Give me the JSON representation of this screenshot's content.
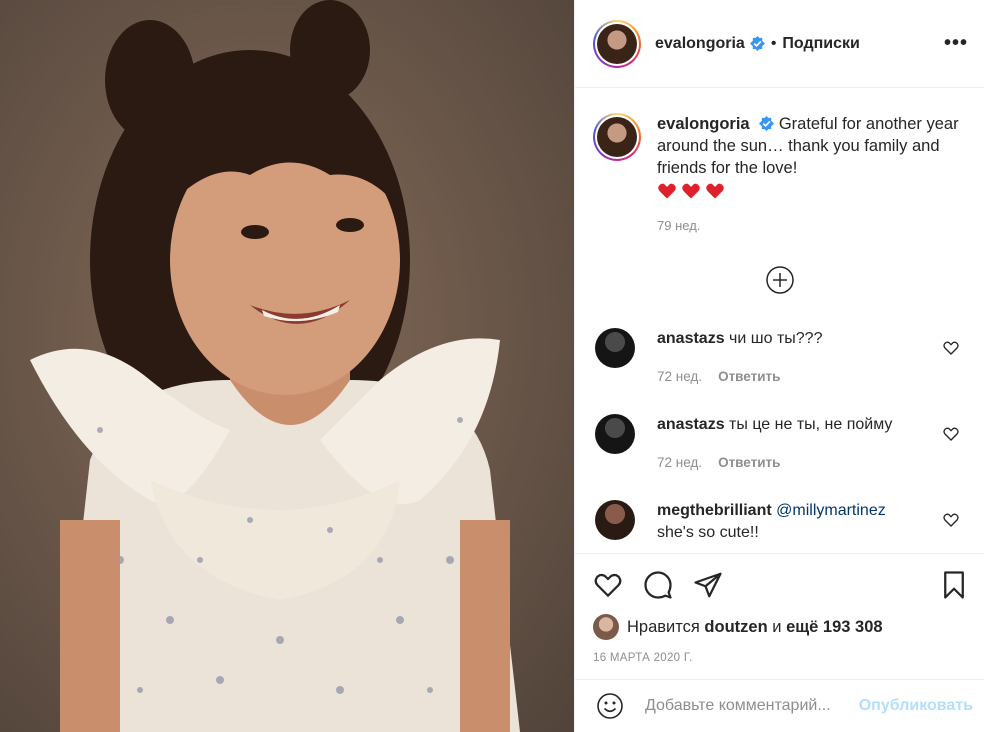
{
  "post": {
    "username": "evalongoria",
    "follow_separator": "•",
    "follow_label": "Подписки",
    "more_label": "•••",
    "caption_text": "Grateful for another year around the sun… thank you family and friends for the love!",
    "caption_time": "79 нед.",
    "image_icon": "photo-of-smiling-girl"
  },
  "comments": [
    {
      "username": "anastazs",
      "text": "чи шо ты???",
      "time": "72 нед.",
      "reply_label": "Ответить"
    },
    {
      "username": "anastazs",
      "text": "ты це не ты, не пойму",
      "time": "72 нед.",
      "reply_label": "Ответить"
    },
    {
      "username": "megthebrilliant",
      "mention": "@millymartinez",
      "text": "she's so cute!!"
    }
  ],
  "likes": {
    "prefix": "Нравится",
    "user": "doutzen",
    "conj": "и",
    "others": "ещё 193 308"
  },
  "date": "16 МАРТА 2020 Г.",
  "add_comment": {
    "placeholder": "Добавьте комментарий...",
    "publish_label": "Опубликовать"
  },
  "colors": {
    "verified": "#3897f0",
    "link": "#00376b",
    "muted": "#8e8e8e",
    "publish_disabled": "#b2dffc"
  }
}
